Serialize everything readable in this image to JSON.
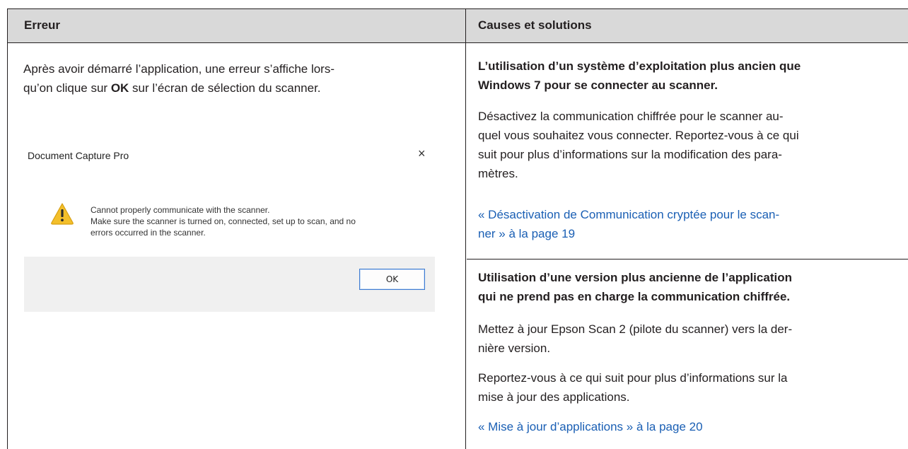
{
  "table": {
    "header": {
      "error": "Erreur",
      "causes": "Causes et solutions"
    },
    "left": {
      "line1": "Après avoir démarré l’application, une erreur s’affiche lors-",
      "line2_pre": "qu’on clique sur ",
      "line2_bold": "OK",
      "line2_post": " sur l’écran de sélection du scanner."
    },
    "dialog": {
      "title": "Document Capture Pro",
      "close": "×",
      "icon": "warning-icon",
      "msg1": "Cannot properly communicate with the scanner.",
      "msg2": "Make sure the scanner is turned on, connected, set up to scan, and no",
      "msg3": "errors occurred in the scanner.",
      "ok": "OK"
    },
    "cause1": {
      "title1": "L’utilisation d’un système d’exploitation plus ancien que",
      "title2": "Windows 7 pour se connecter au scanner.",
      "body1": "Désactivez la communication chiffrée pour le scanner au-",
      "body2": "quel vous souhaitez vous connecter. Reportez-vous à ce qui",
      "body3": "suit pour plus d’informations sur la modification des para-",
      "body4": "mètres.",
      "link1": "« Désactivation de Communication cryptée pour le scan-",
      "link2": "ner » à la page 19"
    },
    "cause2": {
      "title1": "Utilisation d’une version plus ancienne de l’application",
      "title2": "qui ne prend pas en charge la communication chiffrée.",
      "body1": "Mettez à jour Epson Scan 2 (pilote du scanner) vers la der-",
      "body2": "nière version.",
      "body3": "Reportez-vous à ce qui suit pour plus d’informations sur la",
      "body4": "mise à jour des applications.",
      "link": "« Mise à jour d’applications » à la page 20"
    }
  }
}
